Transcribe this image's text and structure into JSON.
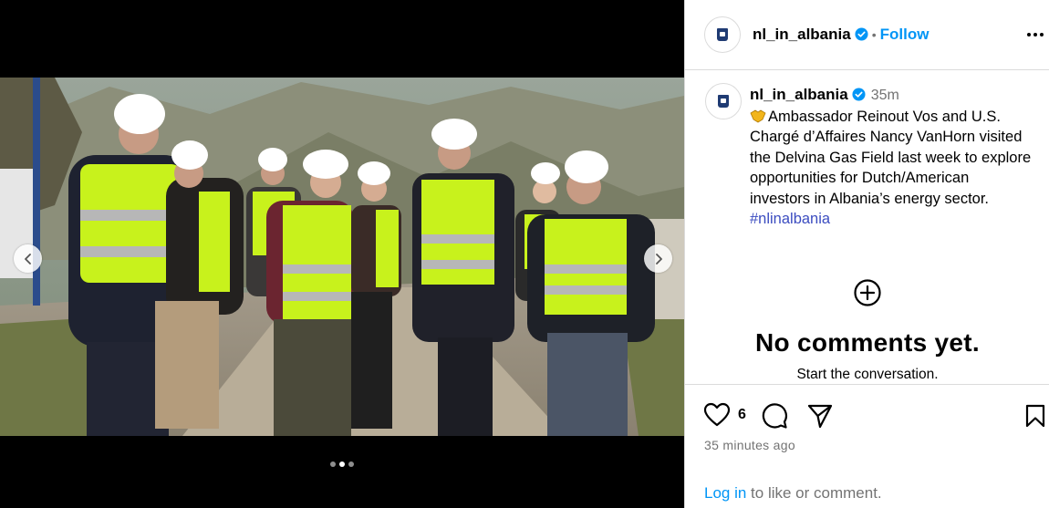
{
  "post": {
    "username": "nl_in_albania",
    "follow_label": "Follow",
    "separator": "•",
    "time_short": "35m",
    "caption_text": "Ambassador Reinout Vos and U.S. Chargé d’Affaires Nancy VanHorn visited the Delvina Gas Field last week to explore opportunities for Dutch/American investors in Albania’s energy sector.",
    "hashtag": "#nlinalbania",
    "verified_icon": "verified-badge-icon",
    "caption_emoji": "handshake-emoji-icon"
  },
  "carousel": {
    "slide_count": 3,
    "active_index": 1,
    "prev_icon": "chevron-left-icon",
    "next_icon": "chevron-right-icon"
  },
  "comments": {
    "empty_title": "No comments yet.",
    "empty_subtitle": "Start the conversation.",
    "empty_icon": "plus-circle-icon"
  },
  "actions": {
    "like_count": "6",
    "time_ago": "35 minutes ago",
    "login_link": "Log in",
    "login_text": " to like or comment.",
    "icons": [
      "heart-icon",
      "comment-icon",
      "share-icon",
      "bookmark-icon",
      "more-icon"
    ]
  },
  "colors": {
    "accent": "#0095f6",
    "verified": "#0095f6",
    "hashtag": "#3b4cc0",
    "muted": "#737373",
    "border": "#dbdbdb"
  }
}
